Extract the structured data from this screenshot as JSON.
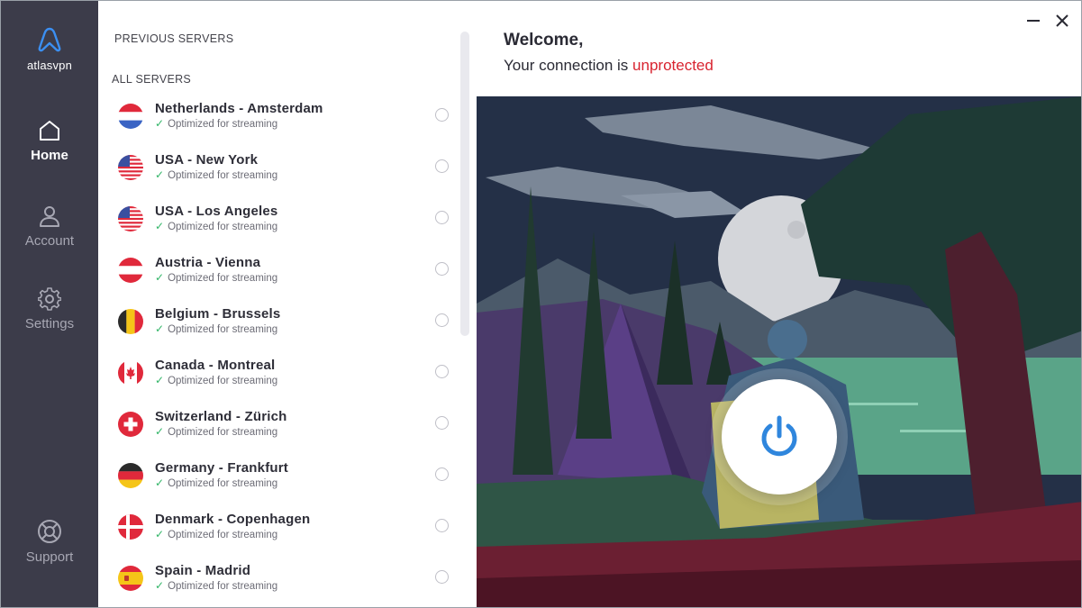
{
  "app": {
    "logo_text": "atlasvpn"
  },
  "nav": {
    "home": "Home",
    "account": "Account",
    "settings": "Settings",
    "support": "Support"
  },
  "servers": {
    "previous_title": "PREVIOUS SERVERS",
    "all_title": "ALL SERVERS",
    "items": [
      {
        "name": "Netherlands - Amsterdam",
        "sub": "Optimized for streaming",
        "flag": "netherlands-flag"
      },
      {
        "name": "USA - New York",
        "sub": "Optimized for streaming",
        "flag": "usa-flag"
      },
      {
        "name": "USA - Los Angeles",
        "sub": "Optimized for streaming",
        "flag": "usa-flag"
      },
      {
        "name": "Austria - Vienna",
        "sub": "Optimized for streaming",
        "flag": "austria-flag"
      },
      {
        "name": "Belgium - Brussels",
        "sub": "Optimized for streaming",
        "flag": "belgium-flag"
      },
      {
        "name": "Canada - Montreal",
        "sub": "Optimized for streaming",
        "flag": "canada-flag"
      },
      {
        "name": "Switzerland - Zürich",
        "sub": "Optimized for streaming",
        "flag": "switzerland-flag"
      },
      {
        "name": "Germany - Frankfurt",
        "sub": "Optimized for streaming",
        "flag": "germany-flag"
      },
      {
        "name": "Denmark - Copenhagen",
        "sub": "Optimized for streaming",
        "flag": "denmark-flag"
      },
      {
        "name": "Spain - Madrid",
        "sub": "Optimized for streaming",
        "flag": "spain-flag"
      }
    ]
  },
  "main": {
    "welcome": "Welcome,",
    "status_prefix": "Your connection is",
    "status_value": "unprotected",
    "power_icon": "power-icon"
  },
  "colors": {
    "sidebar": "#3c3c4a",
    "accent_blue": "#2f86dd",
    "unprotected_red": "#d8232f",
    "check_green": "#31b567"
  }
}
